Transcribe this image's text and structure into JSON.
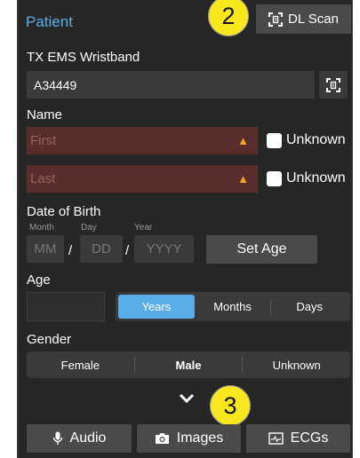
{
  "patient": {
    "section_title": "Patient",
    "dl_scan_label": "DL Scan"
  },
  "markers": {
    "top": "2",
    "bottom": "3"
  },
  "wristband": {
    "label": "TX EMS Wristband",
    "value": "A34449"
  },
  "name": {
    "label": "Name",
    "first_placeholder": "First",
    "last_placeholder": "Last",
    "unknown_label": "Unknown"
  },
  "dob": {
    "label": "Date of Birth",
    "month_label": "Month",
    "day_label": "Day",
    "year_label": "Year",
    "month_placeholder": "MM",
    "day_placeholder": "DD",
    "year_placeholder": "YYYY",
    "separator": "/",
    "set_age_label": "Set Age"
  },
  "age": {
    "label": "Age",
    "units": [
      "Years",
      "Months",
      "Days"
    ],
    "selected": "Years"
  },
  "gender": {
    "label": "Gender",
    "options": [
      "Female",
      "Male",
      "Unknown"
    ],
    "selected": "Male"
  },
  "bottom_bar": {
    "audio": "Audio",
    "images": "Images",
    "ecgs": "ECGs"
  },
  "colors": {
    "accent": "#5aaee8",
    "error_field": "#5a2d2d",
    "warning": "#f5a623",
    "marker": "#f8e71c"
  }
}
